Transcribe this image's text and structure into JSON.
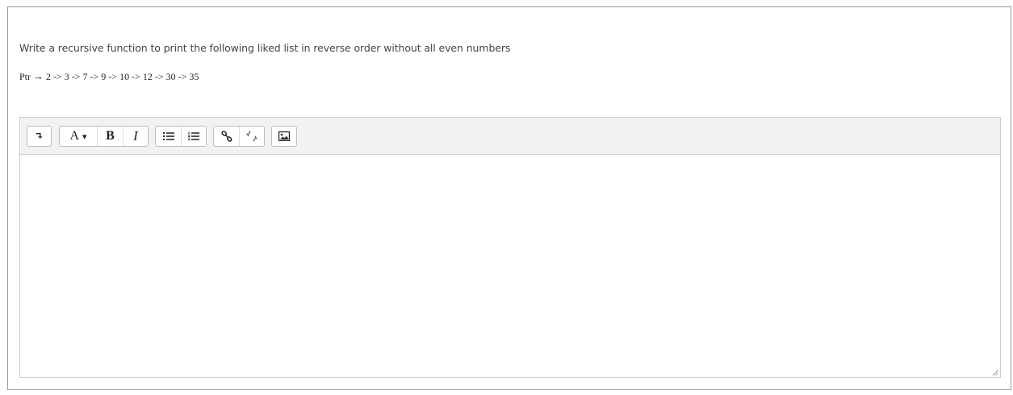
{
  "question": {
    "prompt": "Write a recursive function to print the following liked list in reverse order without all even numbers",
    "ptr_label": "Ptr",
    "ptr_arrow": "→",
    "list_text": "2 -> 3 -> 7 -> 9 -> 10 -> 12 -> 30 -> 35"
  },
  "editor": {
    "toolbar": {
      "collapse_glyph": "↴",
      "font_label": "A",
      "font_caret": "▾",
      "bold_label": "B",
      "italic_label": "I"
    },
    "content": ""
  }
}
